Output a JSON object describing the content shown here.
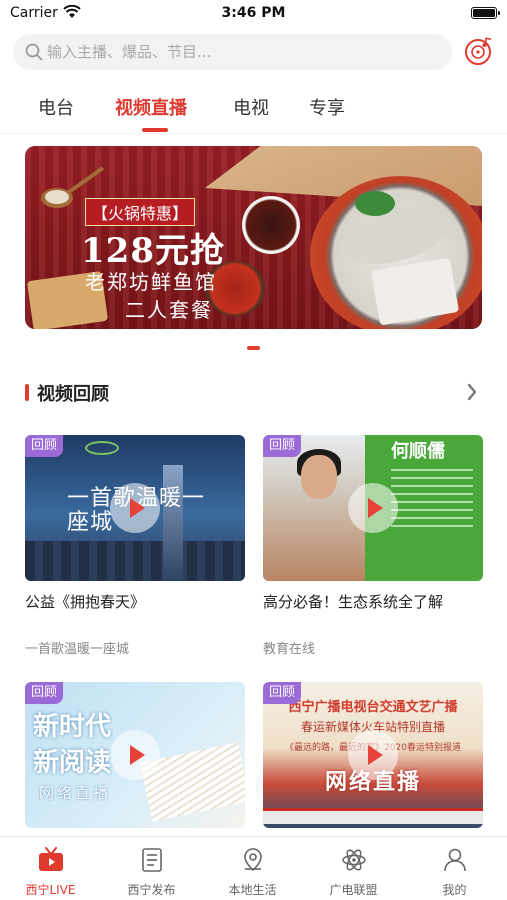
{
  "status": {
    "carrier": "Carrier",
    "time": "3:46 PM"
  },
  "search": {
    "placeholder": "输入主播、爆品、节目..."
  },
  "tabs": [
    {
      "label": "电台",
      "active": false
    },
    {
      "label": "视频直播",
      "active": true
    },
    {
      "label": "电视",
      "active": false
    },
    {
      "label": "专享",
      "active": false
    }
  ],
  "banner": {
    "tag": "【火锅特惠】",
    "price": "128元抢",
    "line1": "老郑坊鲜鱼馆",
    "line2": "二人套餐",
    "page_count": 1,
    "current_page": 1
  },
  "section": {
    "title": "视频回顾",
    "more_icon": "chevron-right-icon"
  },
  "videos": [
    {
      "badge": "回顾",
      "title": "公益《拥抱春天》",
      "subtitle": "一首歌温暖一座城",
      "thumb_text": "一首歌温暖一座城"
    },
    {
      "badge": "回顾",
      "title": "高分必备！生态系统全了解",
      "subtitle": "教育在线",
      "thumb_text": "何顺儒"
    },
    {
      "badge": "回顾",
      "title": "",
      "subtitle": "",
      "thumb_text_1": "新时代",
      "thumb_text_2": "新阅读",
      "thumb_text_3": "网络直播"
    },
    {
      "badge": "回顾",
      "title": "",
      "subtitle": "",
      "thumb_text_1": "西宁广播电视台交通文艺广播",
      "thumb_text_2": "春运新媒体火车站特别直播",
      "thumb_text_3": "《最远的路，最近的家》2020春运特别报道",
      "thumb_text_4": "网络直播"
    }
  ],
  "bottom_nav": [
    {
      "label": "西宁LIVE",
      "icon": "tv-icon",
      "active": true
    },
    {
      "label": "西宁发布",
      "icon": "document-icon",
      "active": false
    },
    {
      "label": "本地生活",
      "icon": "location-icon",
      "active": false
    },
    {
      "label": "广电联盟",
      "icon": "atom-icon",
      "active": false
    },
    {
      "label": "我的",
      "icon": "person-icon",
      "active": false
    }
  ],
  "colors": {
    "accent": "#e03a2f",
    "badge": "#9a6ad6",
    "text": "#222222",
    "muted": "#888888"
  }
}
